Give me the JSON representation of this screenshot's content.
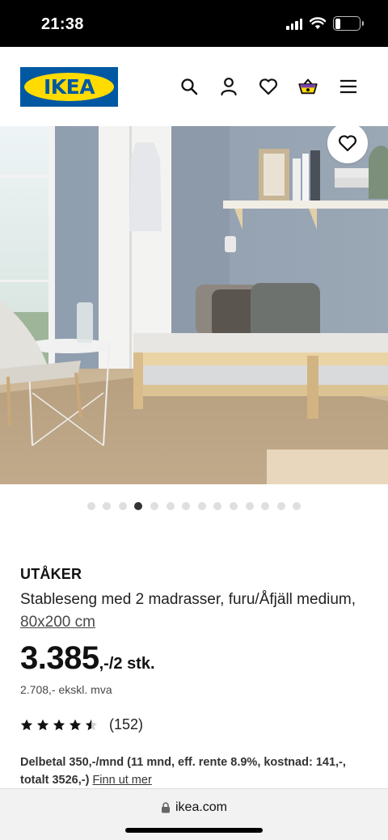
{
  "status_bar": {
    "time": "21:38",
    "battery_level": "6"
  },
  "header": {
    "logo_text": "IKEA",
    "brand_colors": {
      "blue": "#0058A3",
      "yellow": "#FFDB00"
    },
    "icons": [
      "search-icon",
      "profile-icon",
      "heart-icon",
      "shopping-bag-icon",
      "menu-icon"
    ]
  },
  "gallery": {
    "image_count": 14,
    "active_index": 3
  },
  "product": {
    "name": "UTÅKER",
    "description": "Stableseng med 2 madrasser, furu/Åfjäll medium,",
    "size_link": "80x200 cm",
    "price_main": "3.385",
    "price_suffix": ",-/2 stk.",
    "price_ex_vat": "2.708,- ekskl. mva",
    "rating": 4.5,
    "review_count": "(152)",
    "financing_text": "Delbetal 350,-/mnd (11 mnd, eff. rente 8.9%, kostnad: 141,-, totalt 3526,-)",
    "financing_link": "Finn ut mer"
  },
  "browser": {
    "url": "ikea.com"
  }
}
